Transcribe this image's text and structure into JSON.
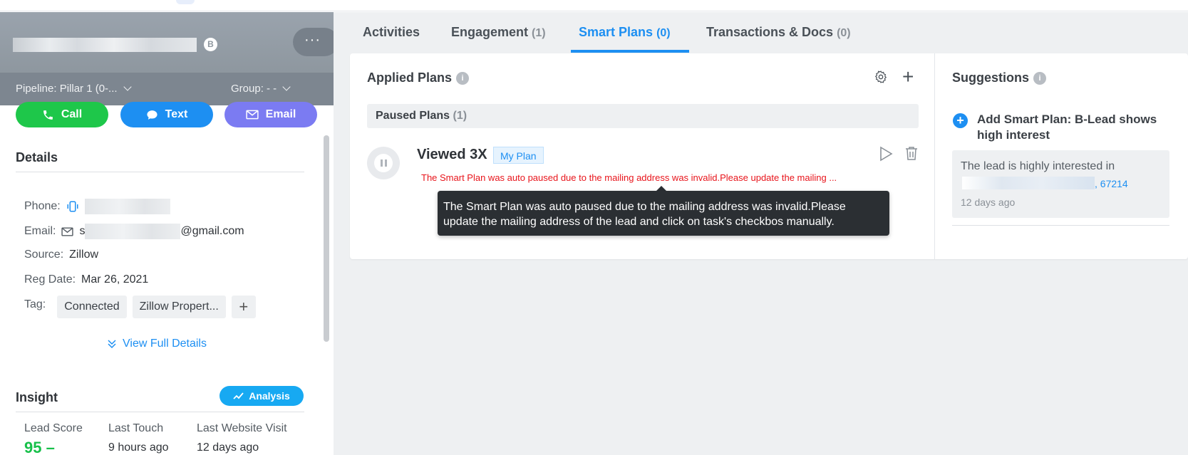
{
  "contact": {
    "badge": "B",
    "more": "···",
    "pipeline": "Pipeline:  Pillar 1 (0-...",
    "group": "Group:  - -"
  },
  "actions": {
    "call": "Call",
    "text": "Text",
    "email": "Email"
  },
  "details": {
    "title": "Details",
    "phone_label": "Phone:",
    "email_label": "Email:",
    "email_prefix": "s",
    "email_domain": "@gmail.com",
    "source_label": "Source:",
    "source_value": "Zillow",
    "reg_label": "Reg Date:",
    "reg_value": "Mar 26, 2021",
    "tag_label": "Tag:",
    "tags": [
      "Connected",
      "Zillow Propert..."
    ],
    "tag_add": "+",
    "view_full": "View Full Details"
  },
  "insight": {
    "title": "Insight",
    "analysis": "Analysis",
    "labels": [
      "Lead Score",
      "Last Touch",
      "Last Website Visit"
    ],
    "score": "95",
    "score_suffix": "–",
    "last_touch": "9 hours ago",
    "last_visit": "12 days ago"
  },
  "tabs": [
    {
      "label": "Activities",
      "count": ""
    },
    {
      "label": "Engagement",
      "count": "(1)"
    },
    {
      "label": "Smart Plans",
      "count": "(0)"
    },
    {
      "label": "Transactions & Docs",
      "count": "(0)"
    }
  ],
  "applied": {
    "title": "Applied Plans",
    "paused_label": "Paused Plans",
    "paused_count": "(1)",
    "plan_name": "Viewed 3X",
    "plan_tag": "My Plan",
    "warning": "The Smart Plan was auto paused due to the mailing address was invalid.Please update the mailing ...",
    "tooltip_line1": "The Smart Plan was auto paused due to the mailing address was invalid.Please",
    "tooltip_line2": "update the mailing address of the lead and click on task's checkbos manually."
  },
  "suggestions": {
    "title": "Suggestions",
    "item": "Add Smart Plan: B-Lead shows high interest",
    "desc": "The lead is highly interested in",
    "link_suffix": ", 67214",
    "time": "12 days ago"
  },
  "colors": {
    "accent": "#1d8ff2",
    "call": "#1ec74a",
    "email": "#7b7bf2",
    "warning": "#e8141b",
    "score": "#17c04a"
  }
}
